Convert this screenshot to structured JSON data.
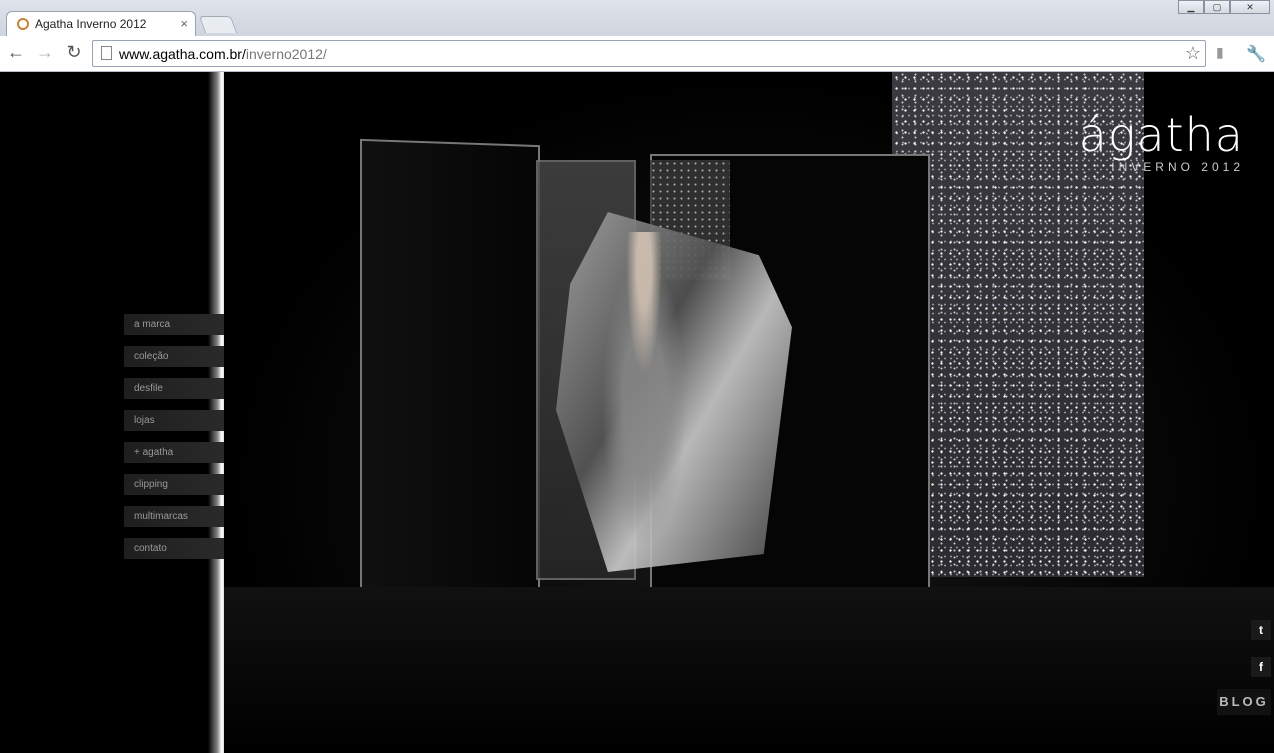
{
  "browser": {
    "tab_title": "Agatha Inverno 2012",
    "tab_close": "×",
    "url_host": "www.agatha.com.br/",
    "url_path": "inverno2012/",
    "window_controls": {
      "minimize": "▁",
      "maximize": "▢",
      "close": "✕"
    },
    "icons": {
      "back": "back-arrow-icon",
      "forward": "forward-arrow-icon",
      "reload": "reload-icon",
      "star": "star-icon",
      "wrench": "wrench-icon"
    }
  },
  "site": {
    "logo": "ágatha",
    "logo_sub": "INVERNO 2012",
    "menu": [
      {
        "label": "a marca"
      },
      {
        "label": "coleção"
      },
      {
        "label": "desfile"
      },
      {
        "label": "lojas"
      },
      {
        "label": "+ agatha"
      },
      {
        "label": "clipping"
      },
      {
        "label": "multimarcas"
      },
      {
        "label": "contato"
      }
    ],
    "social": {
      "twitter": "t",
      "facebook": "f"
    },
    "blog_label": "BLOG"
  }
}
